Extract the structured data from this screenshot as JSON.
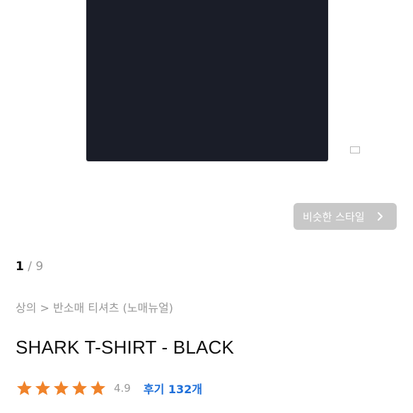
{
  "similar_style_button": {
    "label": "비슷한 스타일",
    "icon": "chevron-right-icon"
  },
  "pager": {
    "current": "1",
    "separator": "/",
    "total": "9"
  },
  "breadcrumb": {
    "category": "상의",
    "separator": ">",
    "subcategory": "반소매 티셔츠",
    "brand": "(노매뉴얼)"
  },
  "product": {
    "title": "SHARK T-SHIRT - BLACK",
    "star_count": 5,
    "rating": "4.9",
    "reviews_label": "후기",
    "reviews_count": "132개"
  },
  "colors": {
    "shirt": "#1a1d28",
    "star": "#f0832a",
    "link": "#1e6fd9",
    "muted_text": "#9a9a9a",
    "button_bg": "#c8c8c8"
  }
}
